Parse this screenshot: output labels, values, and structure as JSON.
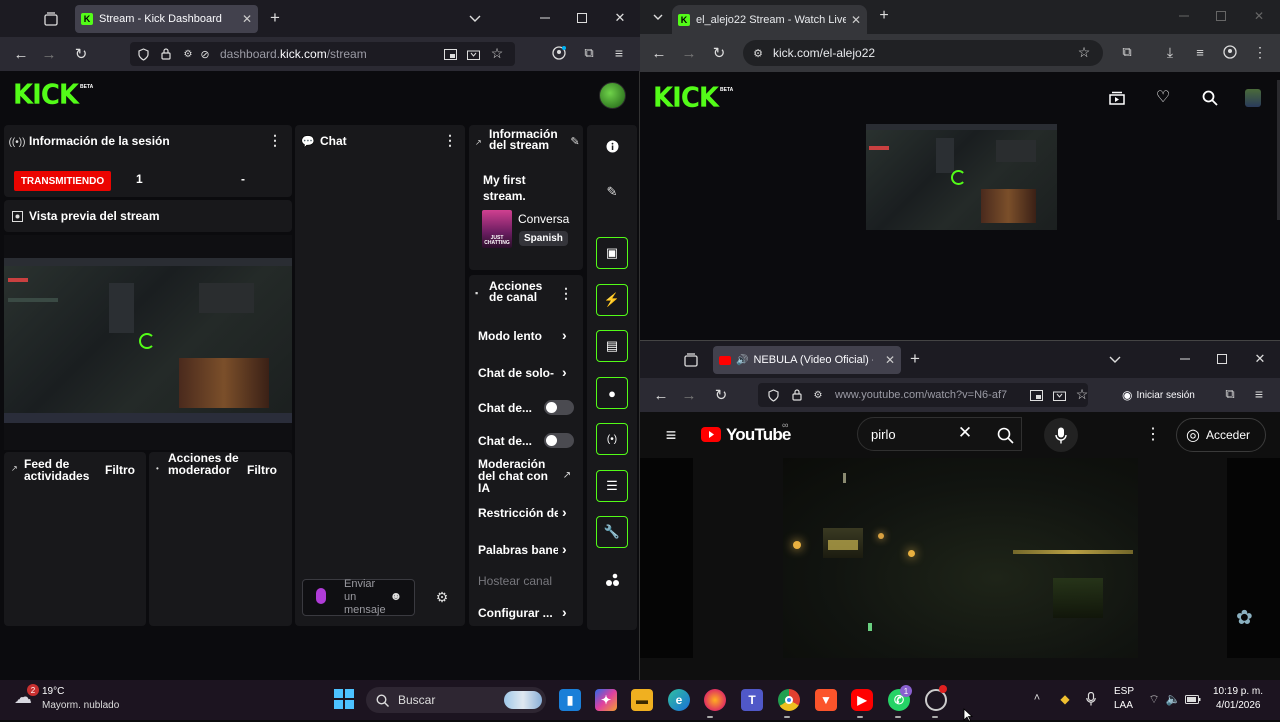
{
  "left_window": {
    "tab_title": "Stream - Kick Dashboard",
    "url_prefix": "dashboard.",
    "url_domain": "kick.com",
    "url_path": "/stream",
    "logo": "KICK",
    "beta": "BETA",
    "session": {
      "title": "Información de la sesión",
      "status_badge": "TRANSMITIENDO",
      "viewers": "1",
      "dash": "-"
    },
    "preview_title": "Vista previa del stream",
    "chat": {
      "title": "Chat",
      "input_placeholder": "Enviar un mensaje"
    },
    "stream_info": {
      "title": "Información del stream",
      "stream_title": "My first stream.",
      "category": "Conversa",
      "language": "Spanish",
      "thumb_text": "JUST CHATTING"
    },
    "channel_actions": {
      "title": "Acciones de canal",
      "items": [
        {
          "label": "Modo lento"
        },
        {
          "label": "Chat de solo-"
        },
        {
          "label": "Chat de..."
        },
        {
          "label": "Chat de..."
        },
        {
          "label": "Moderación del chat con IA"
        },
        {
          "label": "Restricción de"
        },
        {
          "label": "Palabras bane"
        },
        {
          "label": "Hostear canal"
        },
        {
          "label": "Configurar ..."
        }
      ]
    },
    "activity_feed": {
      "title": "Feed de actividades",
      "filter": "Filtro"
    },
    "mod_actions": {
      "title": "Acciones de moderador",
      "filter": "Filtro"
    }
  },
  "right_window": {
    "tab_title": "el_alejo22 Stream - Watch Live",
    "url": "kick.com/el-alejo22",
    "logo": "KICK",
    "beta": "BETA"
  },
  "youtube_window": {
    "tab_title": "NEBULA (Video Oficial) - Pi",
    "url": "www.youtube.com/watch?v=N6-af7",
    "signin_button": "Iniciar sesión",
    "logo_text": "YouTube",
    "search_value": "pirlo",
    "login_button": "Acceder"
  },
  "taskbar": {
    "weather_temp": "19°C",
    "weather_desc": "Mayorm. nublado",
    "weather_badge": "2",
    "search_label": "Buscar",
    "lang_line1": "ESP",
    "lang_line2": "LAA",
    "time": "10:19 p. m.",
    "date": "4/01/2026",
    "teams_badge": "1"
  },
  "colors": {
    "kick_green": "#53fc18",
    "live_red": "#eb0400",
    "youtube_red": "#ff0000"
  }
}
